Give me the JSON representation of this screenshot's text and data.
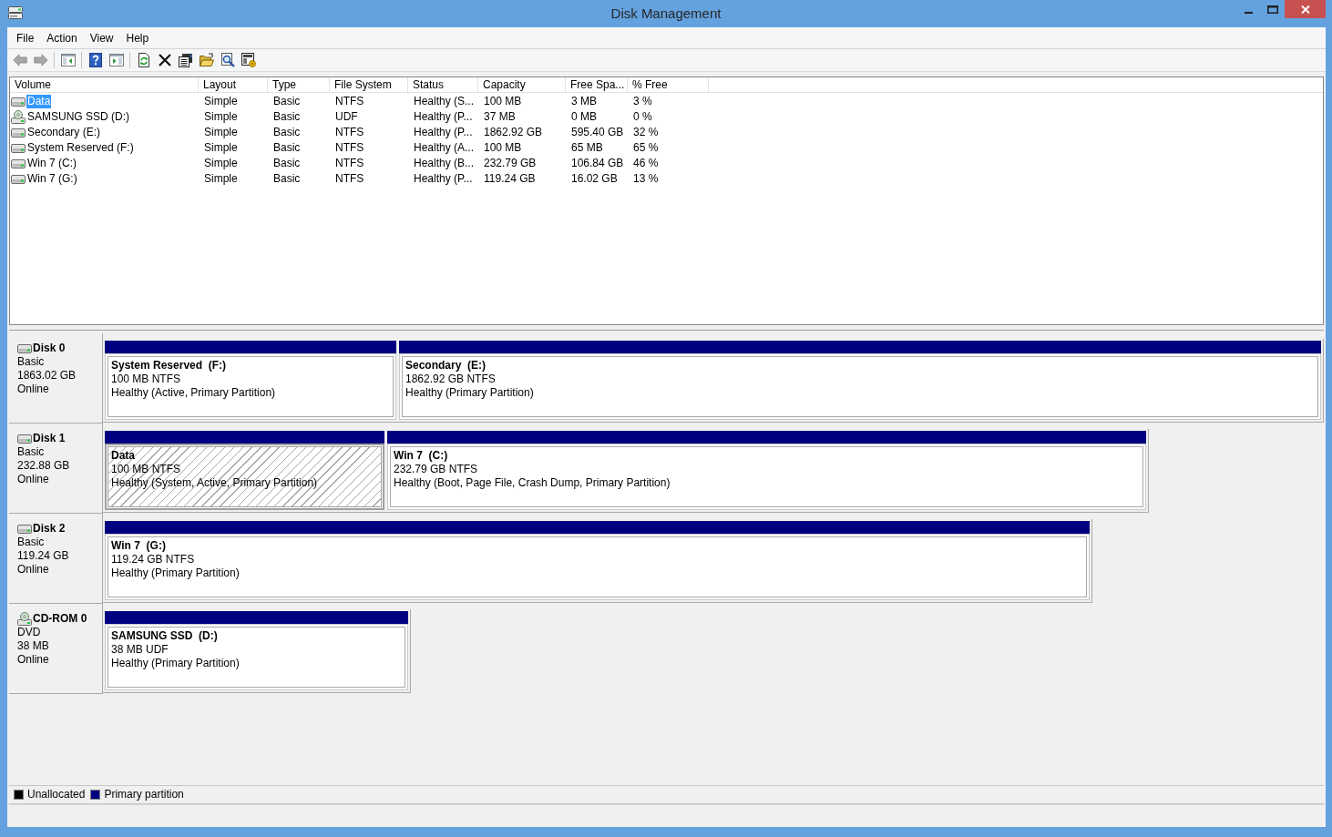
{
  "window": {
    "title": "Disk Management"
  },
  "menu": [
    "File",
    "Action",
    "View",
    "Help"
  ],
  "toolbar": [
    {
      "disabled": true
    },
    {
      "disabled": true
    },
    {
      "disabled": false
    },
    {
      "disabled": false
    },
    {
      "disabled": false
    },
    {
      "disabled": false
    },
    {
      "disabled": false
    },
    {
      "disabled": false
    },
    {
      "disabled": false
    },
    {
      "disabled": false
    },
    {
      "disabled": false
    }
  ],
  "volume_table": {
    "columns": [
      "Volume",
      "Layout",
      "Type",
      "File System",
      "Status",
      "Capacity",
      "Free Spa...",
      "% Free"
    ],
    "rows": [
      {
        "kind": "disk",
        "selected": true,
        "cells": [
          "Data",
          "Simple",
          "Basic",
          "NTFS",
          "Healthy (S...",
          "100 MB",
          "3 MB",
          "3 %"
        ]
      },
      {
        "kind": "cdrom",
        "selected": false,
        "cells": [
          "SAMSUNG SSD (D:)",
          "Simple",
          "Basic",
          "UDF",
          "Healthy (P...",
          "37 MB",
          "0 MB",
          "0 %"
        ]
      },
      {
        "kind": "disk",
        "selected": false,
        "cells": [
          "Secondary (E:)",
          "Simple",
          "Basic",
          "NTFS",
          "Healthy (P...",
          "1862.92 GB",
          "595.40 GB",
          "32 %"
        ]
      },
      {
        "kind": "disk",
        "selected": false,
        "cells": [
          "System Reserved (F:)",
          "Simple",
          "Basic",
          "NTFS",
          "Healthy (A...",
          "100 MB",
          "65 MB",
          "65 %"
        ]
      },
      {
        "kind": "disk",
        "selected": false,
        "cells": [
          "Win 7 (C:)",
          "Simple",
          "Basic",
          "NTFS",
          "Healthy (B...",
          "232.79 GB",
          "106.84 GB",
          "46 %"
        ]
      },
      {
        "kind": "disk",
        "selected": false,
        "cells": [
          "Win 7 (G:)",
          "Simple",
          "Basic",
          "NTFS",
          "Healthy (P...",
          "119.24 GB",
          "16.02 GB",
          "13 %"
        ]
      }
    ]
  },
  "disks": [
    {
      "kind": "disk",
      "name": "Disk 0",
      "type": "Basic",
      "size": "1863.02 GB",
      "status": "Online",
      "partitions": [
        {
          "name": "System Reserved  (F:)",
          "size": "100 MB NTFS",
          "status": "Healthy (Active, Primary Partition)",
          "selected": false
        },
        {
          "name": "Secondary  (E:)",
          "size": "1862.92 GB NTFS",
          "status": "Healthy (Primary Partition)",
          "selected": false
        }
      ]
    },
    {
      "kind": "disk",
      "name": "Disk 1",
      "type": "Basic",
      "size": "232.88 GB",
      "status": "Online",
      "partitions": [
        {
          "name": "Data",
          "size": "100 MB NTFS",
          "status": "Healthy (System, Active, Primary Partition)",
          "selected": true
        },
        {
          "name": "Win 7  (C:)",
          "size": "232.79 GB NTFS",
          "status": "Healthy (Boot, Page File, Crash Dump, Primary Partition)",
          "selected": false
        }
      ]
    },
    {
      "kind": "disk",
      "name": "Disk 2",
      "type": "Basic",
      "size": "119.24 GB",
      "status": "Online",
      "partitions": [
        {
          "name": "Win 7  (G:)",
          "size": "119.24 GB NTFS",
          "status": "Healthy (Primary Partition)",
          "selected": false
        }
      ]
    },
    {
      "kind": "cdrom",
      "name": "CD-ROM 0",
      "type": "DVD",
      "size": "38 MB",
      "status": "Online",
      "partitions": [
        {
          "name": "SAMSUNG SSD  (D:)",
          "size": "38 MB UDF",
          "status": "Healthy (Primary Partition)",
          "selected": false
        }
      ]
    }
  ],
  "legend": [
    {
      "label": "Unallocated",
      "color": "#000000"
    },
    {
      "label": "Primary partition",
      "color": "#000080"
    }
  ]
}
